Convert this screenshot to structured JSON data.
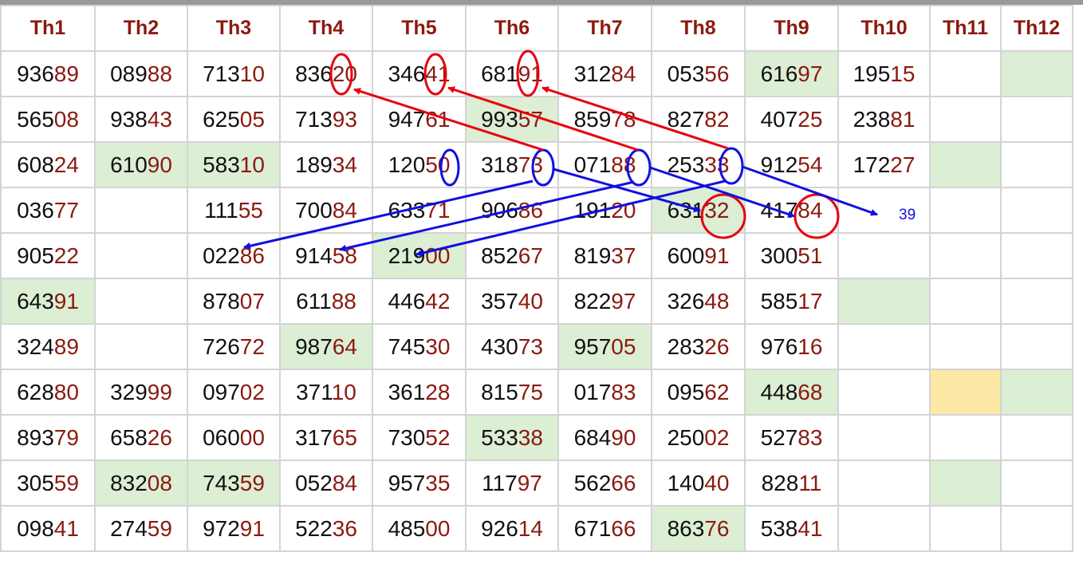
{
  "headers": [
    "Th1",
    "Th2",
    "Th3",
    "Th4",
    "Th5",
    "Th6",
    "Th7",
    "Th8",
    "Th9",
    "Th10",
    "Th11",
    "Th12"
  ],
  "rows": [
    [
      "93689",
      "08988",
      "71310",
      "83620",
      "34641",
      "68191",
      "31284",
      "05356",
      "61697",
      "19515",
      "",
      ""
    ],
    [
      "56508",
      "93843",
      "62505",
      "71393",
      "94761",
      "99357",
      "85978",
      "82782",
      "40725",
      "23881",
      "",
      ""
    ],
    [
      "60824",
      "61090",
      "58310",
      "18934",
      "12050",
      "31873",
      "07188",
      "25333",
      "91254",
      "17227",
      "",
      ""
    ],
    [
      "03677",
      "",
      "11155",
      "70084",
      "63371",
      "90686",
      "19120",
      "63132",
      "41784",
      "",
      "",
      ""
    ],
    [
      "90522",
      "",
      "02286",
      "91458",
      "21900",
      "85267",
      "81937",
      "60091",
      "30051",
      "",
      "",
      ""
    ],
    [
      "64391",
      "",
      "87807",
      "61188",
      "44642",
      "35740",
      "82297",
      "32648",
      "58517",
      "",
      "",
      ""
    ],
    [
      "32489",
      "",
      "72672",
      "98764",
      "74530",
      "43073",
      "95705",
      "28326",
      "97616",
      "",
      "",
      ""
    ],
    [
      "62880",
      "32999",
      "09702",
      "37110",
      "36128",
      "81575",
      "01783",
      "09562",
      "44868",
      "",
      "",
      ""
    ],
    [
      "89379",
      "65826",
      "06000",
      "31765",
      "73052",
      "53338",
      "68490",
      "25002",
      "52783",
      "",
      "",
      ""
    ],
    [
      "30559",
      "83208",
      "74359",
      "05284",
      "95735",
      "11797",
      "56266",
      "14040",
      "82811",
      "",
      "",
      ""
    ],
    [
      "09841",
      "27459",
      "97291",
      "52236",
      "48500",
      "92614",
      "67166",
      "86376",
      "53841",
      "",
      "",
      ""
    ]
  ],
  "highlights": {
    "green": [
      [
        0,
        8
      ],
      [
        0,
        11
      ],
      [
        1,
        5
      ],
      [
        2,
        1
      ],
      [
        2,
        2
      ],
      [
        2,
        10
      ],
      [
        3,
        7
      ],
      [
        4,
        4
      ],
      [
        5,
        0
      ],
      [
        5,
        9
      ],
      [
        6,
        3
      ],
      [
        6,
        6
      ],
      [
        7,
        8
      ],
      [
        7,
        11
      ],
      [
        8,
        5
      ],
      [
        9,
        1
      ],
      [
        9,
        2
      ],
      [
        9,
        10
      ],
      [
        10,
        7
      ]
    ],
    "yellow": [
      [
        7,
        10
      ]
    ]
  },
  "colors": {
    "header_text": "#8b1a10",
    "digit_suffix": "#8b1a10",
    "cell_green": "#dceed4",
    "cell_yellow": "#fde9a6",
    "annotation_red": "#e8000e",
    "annotation_blue": "#1010e0"
  },
  "annotations": {
    "label_39": "39"
  }
}
